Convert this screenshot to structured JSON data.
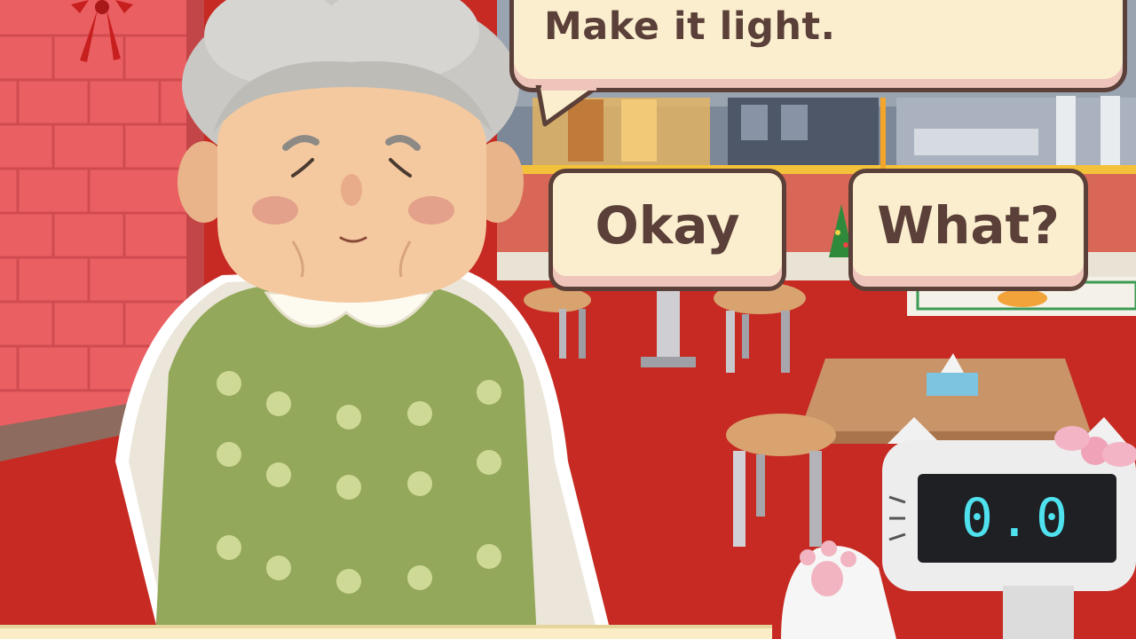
{
  "dialogue": {
    "speech": "Make it light."
  },
  "choices": [
    {
      "label": "Okay"
    },
    {
      "label": "What?"
    }
  ],
  "robot": {
    "display_value": "0.0"
  },
  "colors": {
    "bubble_fill": "#fbeecf",
    "bubble_border": "#5a4038",
    "display_text": "#4fe2ee",
    "floor": "#c82a22"
  }
}
